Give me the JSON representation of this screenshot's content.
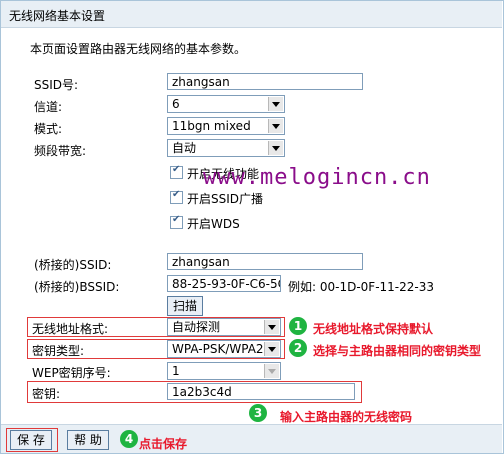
{
  "page": {
    "title": "无线网络基本设置",
    "description": "本页面设置路由器无线网络的基本参数。"
  },
  "form": {
    "ssid_label": "SSID号:",
    "ssid_value": "zhangsan",
    "channel_label": "信道:",
    "channel_value": "6",
    "mode_label": "模式:",
    "mode_value": "11bgn mixed",
    "bandwidth_label": "频段带宽:",
    "bandwidth_value": "自动",
    "checkboxes": [
      {
        "label": "开启无线功能",
        "checked": true
      },
      {
        "label": "开启SSID广播",
        "checked": true
      },
      {
        "label": "开启WDS",
        "checked": true
      }
    ],
    "bridge_ssid_label": "(桥接的)SSID:",
    "bridge_ssid_value": "zhangsan",
    "bridge_bssid_label": "(桥接的)BSSID:",
    "bridge_bssid_value": "88-25-93-0F-C6-5C",
    "bssid_example": "例如: 00-1D-0F-11-22-33",
    "scan_label": "扫描",
    "addr_format_label": "无线地址格式:",
    "addr_format_value": "自动探测",
    "key_type_label": "密钥类型:",
    "key_type_value": "WPA-PSK/WPA2-",
    "wep_index_label": "WEP密钥序号:",
    "wep_index_value": "1",
    "key_label": "密钥:",
    "key_value": "1a2b3c4d"
  },
  "annotations": [
    {
      "number": "1",
      "text": "无线地址格式保持默认"
    },
    {
      "number": "2",
      "text": "选择与主路由器相同的密钥类型"
    },
    {
      "number": "3",
      "text": "输入主路由器的无线密码"
    },
    {
      "number": "4",
      "text": "点击保存"
    }
  ],
  "watermark": "www.melogincn.cn",
  "footer": {
    "save_label": "保 存",
    "help_label": "帮 助"
  },
  "colors": {
    "header_bg": "#e8eff5",
    "annotation_green": "#1fb441",
    "annotation_red": "#e8192c",
    "watermark": "#8a0d8a"
  }
}
